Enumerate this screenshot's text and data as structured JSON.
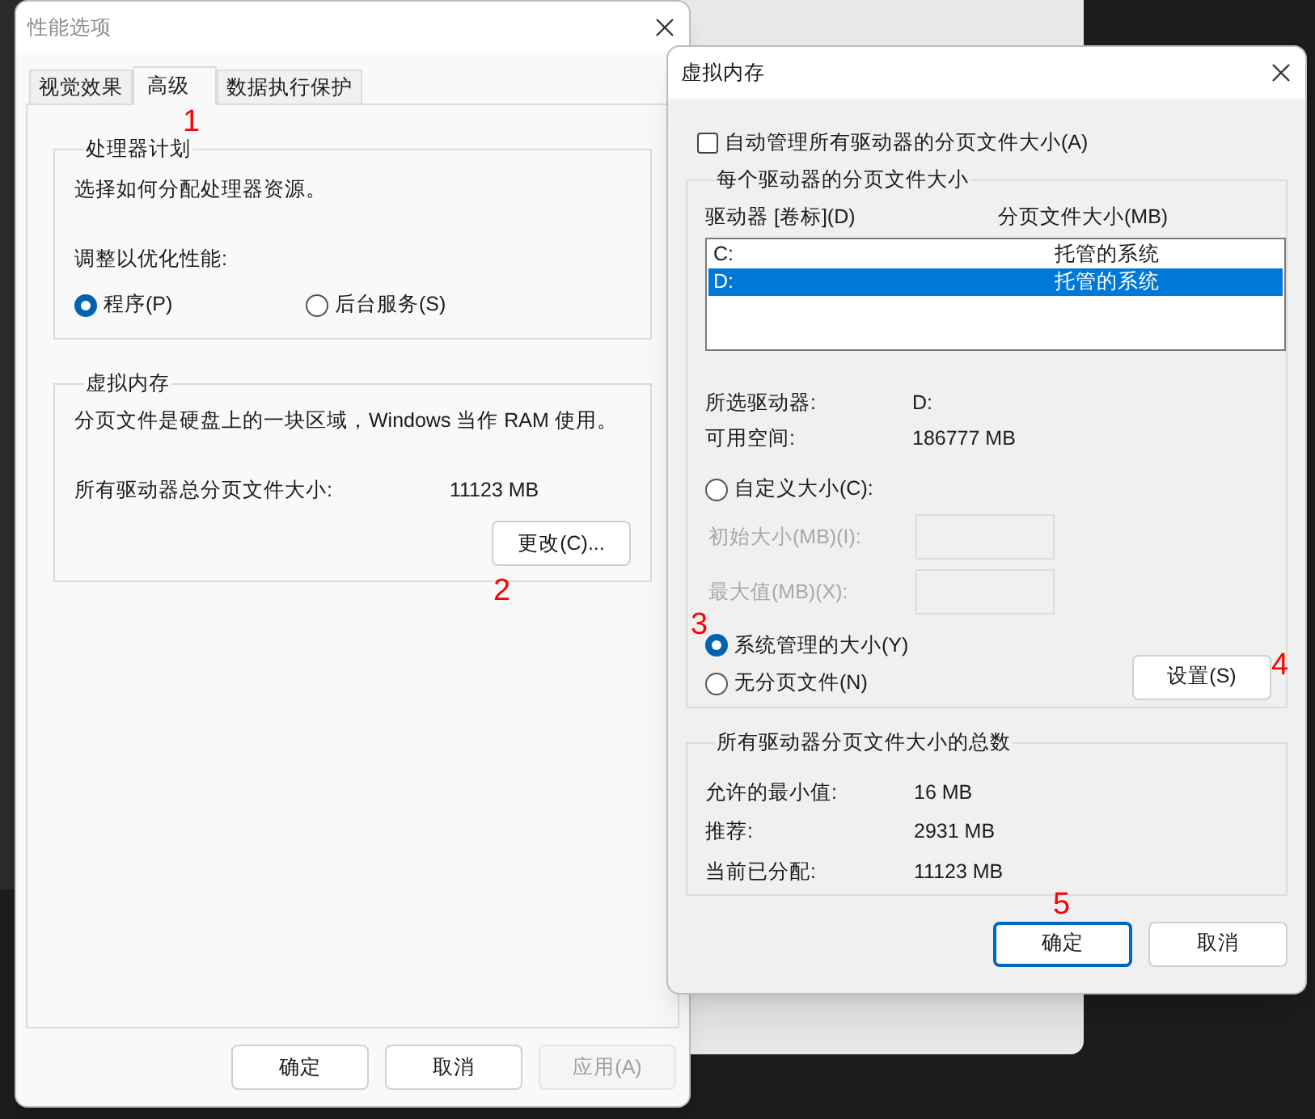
{
  "performance_options": {
    "title": "性能选项",
    "tabs": [
      {
        "label": "视觉效果",
        "selected": false
      },
      {
        "label": "高级",
        "selected": true
      },
      {
        "label": "数据执行保护",
        "selected": false
      }
    ],
    "processor_group": {
      "title": "处理器计划",
      "description": "选择如何分配处理器资源。",
      "prompt": "调整以优化性能:",
      "options": [
        {
          "label": "程序(P)",
          "selected": true
        },
        {
          "label": "后台服务(S)",
          "selected": false
        }
      ]
    },
    "virtual_memory_group": {
      "title": "虚拟内存",
      "description": "分页文件是硬盘上的一块区域，Windows 当作 RAM 使用。",
      "total_label": "所有驱动器总分页文件大小:",
      "total_value": "11123 MB",
      "change_button": "更改(C)..."
    },
    "buttons": [
      {
        "label": "确定",
        "disabled": false
      },
      {
        "label": "取消",
        "disabled": false
      },
      {
        "label": "应用(A)",
        "disabled": true
      }
    ]
  },
  "virtual_memory": {
    "title": "虚拟内存",
    "auto_manage": {
      "label": "自动管理所有驱动器的分页文件大小(A)",
      "checked": false
    },
    "per_drive_group": {
      "title": "每个驱动器的分页文件大小",
      "columns": [
        "驱动器 [卷标](D)",
        "分页文件大小(MB)"
      ],
      "drives": [
        {
          "drive": "C:",
          "size": "托管的系统",
          "selected": false
        },
        {
          "drive": "D:",
          "size": "托管的系统",
          "selected": true
        }
      ],
      "selected_drive_label": "所选驱动器:",
      "selected_drive_value": "D:",
      "free_space_label": "可用空间:",
      "free_space_value": "186777 MB",
      "size_options": [
        {
          "label": "自定义大小(C):",
          "selected": false
        },
        {
          "label": "系统管理的大小(Y)",
          "selected": true
        },
        {
          "label": "无分页文件(N)",
          "selected": false
        }
      ],
      "fields": [
        {
          "label": "初始大小(MB)(I):",
          "disabled": true
        },
        {
          "label": "最大值(MB)(X):",
          "disabled": true
        }
      ],
      "set_button": "设置(S)"
    },
    "totals_group": {
      "title": "所有驱动器分页文件大小的总数",
      "rows": [
        {
          "label": "允许的最小值:",
          "value": "16 MB"
        },
        {
          "label": "推荐:",
          "value": "2931 MB"
        },
        {
          "label": "当前已分配:",
          "value": "11123 MB"
        }
      ]
    },
    "buttons": [
      {
        "label": "确定",
        "default": true
      },
      {
        "label": "取消",
        "default": false
      }
    ]
  },
  "annotations": [
    "1",
    "2",
    "3",
    "4",
    "5"
  ]
}
